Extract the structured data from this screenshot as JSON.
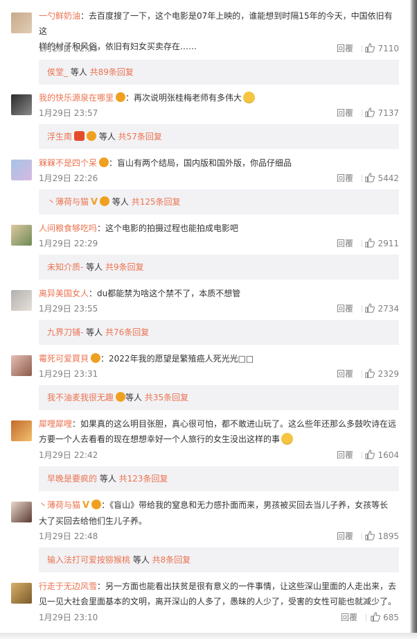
{
  "comments": [
    {
      "username": "一勺鲜奶油",
      "text": "去百度搜了一下，这个电影是07年上映的，谁能想到时隔15年的今天，中国依旧有这",
      "text2": "样的村子和风俗，依旧有妇女买卖存在……",
      "date": "1月29日 22:35",
      "reply": "回覆",
      "likes": "7110",
      "sub_user": "俟堂_",
      "sub_mid": " 等人 ",
      "sub_count": "共89条回复",
      "avatar_colors": [
        "#c8a98a",
        "#e0cdb6"
      ]
    },
    {
      "username": "我的快乐源泉在哪里",
      "text": "再次说明张桂梅老师有多伟大",
      "date": "1月29日 23:57",
      "reply": "回覆",
      "likes": "7137",
      "sub_user": "浮生南",
      "sub_mid": " 等人 ",
      "sub_count": "共57条回复",
      "avatar_colors": [
        "#2b2b2b",
        "#8a8a8a"
      ]
    },
    {
      "username": "槑槑不是四个呆",
      "text": "盲山有两个结局，国内版和国外版，你品仔细品",
      "date": "1月29日 22:26",
      "reply": "回覆",
      "likes": "5442",
      "sub_user": "丶薄荷与猫",
      "sub_mid": " 等人 ",
      "sub_count": "共125条回复",
      "avatar_colors": [
        "#a6c4e6",
        "#d6b8e2"
      ]
    },
    {
      "username": "人间粮食够吃吗",
      "text": "这个电影的拍摄过程也能拍成电影吧",
      "date": "1月29日 22:29",
      "reply": "回覆",
      "likes": "2911",
      "sub_user": "未知介质-",
      "sub_mid": " 等人 ",
      "sub_count": "共9条回复",
      "avatar_colors": [
        "#dcc8a0",
        "#6e8a56"
      ]
    },
    {
      "username": "离异美国女人",
      "text": "du都能禁为啥这个禁不了，本质不想管",
      "date": "1月29日 23:55",
      "reply": "回覆",
      "likes": "2734",
      "sub_user": "九界刀铺-",
      "sub_mid": " 等人 ",
      "sub_count": "共76条回复",
      "avatar_colors": [
        "#b0b0b0",
        "#e8e0d8"
      ]
    },
    {
      "username": "霉死可爱買貝",
      "text": "2022年我的愿望是繁殖癌人死光光□□",
      "date": "1月29日 23:31",
      "reply": "回覆",
      "likes": "2329",
      "sub_user": "我不油麦我很无趣",
      "sub_mid": "等人 ",
      "sub_count": "共35条回复",
      "avatar_colors": [
        "#e6c0b4",
        "#8a5a4a"
      ]
    },
    {
      "username": "犀哩犀哩",
      "text": "如果真的这么明目张胆，真心很可怕，都不敢进山玩了。这么些年还那么多鼓吹诗在远",
      "text2": "方要一个人去看看的现在想想幸好一个人旅行的女生没出这样的事",
      "date": "1月29日 22:42",
      "reply": "回覆",
      "likes": "1604",
      "sub_user": "早晚是要疯的",
      "sub_mid": " 等人 ",
      "sub_count": "共123条回复",
      "avatar_colors": [
        "#c46a2a",
        "#f0c070"
      ]
    },
    {
      "username": "丶薄荷与猫",
      "text": "《盲山》带给我的窒息和无力感扑面而来，男孩被买回去当儿子养，女孩等长",
      "text2": "大了买回去给他们生儿子养。",
      "date": "1月29日 22:48",
      "reply": "回覆",
      "likes": "1895",
      "sub_user": "输入法打可爱按猕猴桃",
      "sub_mid": " 等人 ",
      "sub_count": "共8条回复",
      "avatar_colors": [
        "#e8d6cc",
        "#5a3a32"
      ]
    },
    {
      "username": "行走于无边风雪",
      "text": "另一方面也能看出扶贫是很有意义的一件事情，让这些深山里面的人走出来，去",
      "text2": "见一见大社会里面基本的文明，离开深山的人多了，愚昧的人少了，受害的女性可能也就减少了。",
      "date": "1月29日 23:10",
      "reply": "回覆",
      "likes": "685",
      "avatar_colors": [
        "#d8b06a",
        "#7a5a2a"
      ]
    }
  ]
}
